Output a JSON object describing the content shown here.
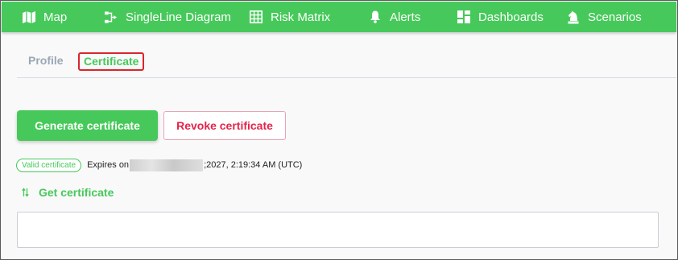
{
  "nav": {
    "items": [
      {
        "label": "Map",
        "icon": "map-icon"
      },
      {
        "label": "SingleLine Diagram",
        "icon": "diagram-icon"
      },
      {
        "label": "Risk Matrix",
        "icon": "grid-icon"
      },
      {
        "label": "Alerts",
        "icon": "bell-icon"
      },
      {
        "label": "Dashboards",
        "icon": "dashboard-icon"
      },
      {
        "label": "Scenarios",
        "icon": "chess-knight-icon"
      }
    ],
    "background": "#46c95a"
  },
  "tabs": {
    "profile": "Profile",
    "certificate": "Certificate",
    "active": "Certificate"
  },
  "actions": {
    "generate_label": "Generate certificate",
    "revoke_label": "Revoke certificate"
  },
  "status": {
    "badge": "Valid certificate",
    "expires_prefix": "Expires on",
    "expires_suffix": ";2027, 2:19:34 AM (UTC)"
  },
  "get_certificate": {
    "label": "Get certificate",
    "icon": "sort-arrows-icon"
  },
  "cert_box": {
    "value": ""
  },
  "colors": {
    "accent": "#46c95a",
    "danger": "#e3244a",
    "highlight_border": "#d9262c"
  }
}
